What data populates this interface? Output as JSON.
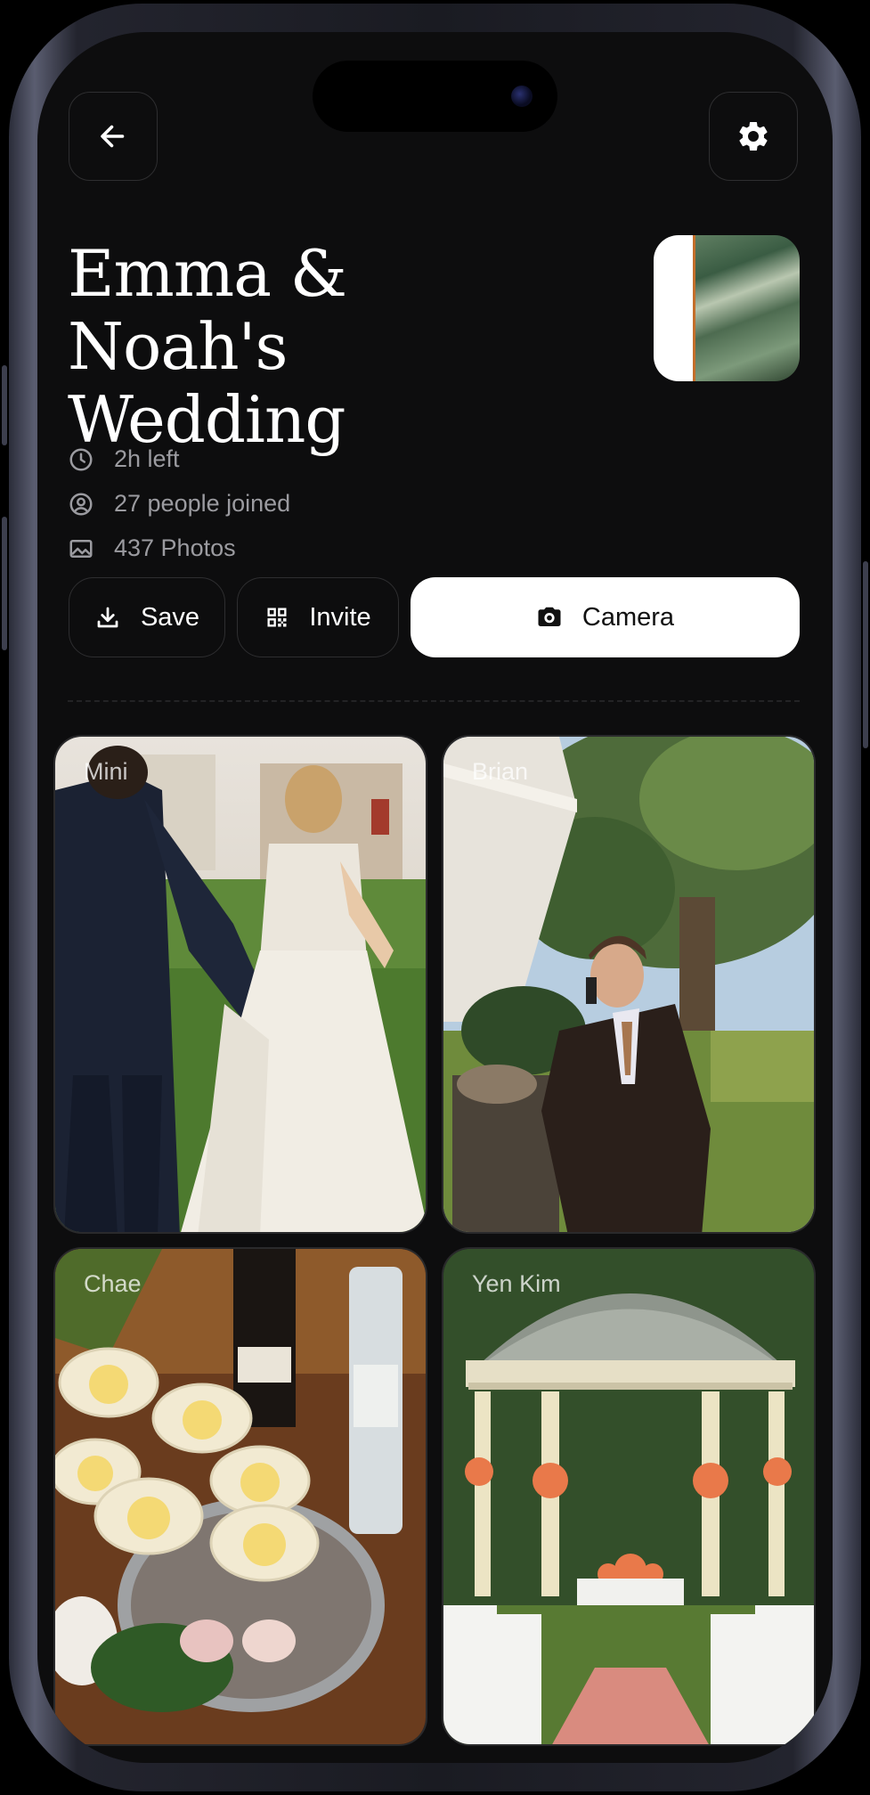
{
  "nav": {
    "back_icon": "arrow-left-icon",
    "settings_icon": "gear-icon"
  },
  "event": {
    "title_line1": "Emma & Noah's",
    "title_line2": "Wedding",
    "time_left": "2h left",
    "people_joined": "27 people joined",
    "photos_count": "437 Photos"
  },
  "actions": {
    "save_label": "Save",
    "invite_label": "Invite",
    "camera_label": "Camera"
  },
  "photos": [
    {
      "author": "Mini",
      "subject": "bride-and-groom-walking"
    },
    {
      "author": "Brian",
      "subject": "guest-on-phone-under-tree"
    },
    {
      "author": "Chae",
      "subject": "champagne-glasses-lemon"
    },
    {
      "author": "Yen Kim",
      "subject": "gazebo-ceremony"
    }
  ],
  "colors": {
    "background": "#0d0d0e",
    "accent": "#ffffff",
    "muted_text": "#9b9ba0"
  }
}
